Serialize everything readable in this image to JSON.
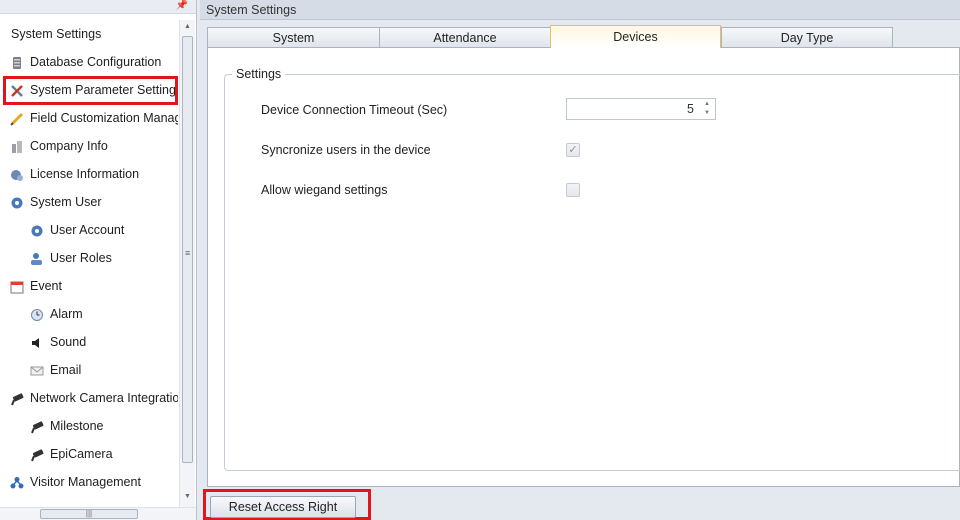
{
  "left_panel": {
    "tree": [
      {
        "label": "System Settings",
        "icon": "none",
        "level": "root"
      },
      {
        "label": "Database Configuration",
        "icon": "database-icon",
        "level": "l1"
      },
      {
        "label": "System Parameter Settings",
        "icon": "tools-icon",
        "level": "l1",
        "selected": true
      },
      {
        "label": "Field Customization Manage",
        "icon": "pencil-icon",
        "level": "l1"
      },
      {
        "label": "Company Info",
        "icon": "building-icon",
        "level": "l1"
      },
      {
        "label": "License Information",
        "icon": "license-icon",
        "level": "l1"
      },
      {
        "label": "System User",
        "icon": "gear-icon",
        "level": "l1"
      },
      {
        "label": "User Account",
        "icon": "gear-icon",
        "level": "l2"
      },
      {
        "label": "User Roles",
        "icon": "user-icon",
        "level": "l2"
      },
      {
        "label": "Event",
        "icon": "calendar-icon",
        "level": "l1"
      },
      {
        "label": "Alarm",
        "icon": "clock-icon",
        "level": "l2"
      },
      {
        "label": "Sound",
        "icon": "speaker-icon",
        "level": "l2"
      },
      {
        "label": "Email",
        "icon": "envelope-icon",
        "level": "l2"
      },
      {
        "label": "Network Camera Integration",
        "icon": "camera-icon",
        "level": "l1"
      },
      {
        "label": "Milestone",
        "icon": "camera-icon",
        "level": "l2"
      },
      {
        "label": "EpiCamera",
        "icon": "camera-icon",
        "level": "l2"
      },
      {
        "label": "Visitor Management",
        "icon": "visitor-icon",
        "level": "l1"
      }
    ]
  },
  "right_panel": {
    "title": "System Settings",
    "tabs": [
      {
        "label": "System",
        "active": false
      },
      {
        "label": "Attendance",
        "active": false
      },
      {
        "label": "Devices",
        "active": true
      },
      {
        "label": "Day Type",
        "active": false
      }
    ],
    "group_title": "Settings",
    "fields": {
      "timeout_label": "Device Connection Timeout (Sec)",
      "timeout_value": "5",
      "sync_label": "Syncronize users in the device",
      "sync_checked": true,
      "wiegand_label": "Allow wiegand settings",
      "wiegand_checked": false
    },
    "reset_button": "Reset Access Right"
  },
  "colors": {
    "highlight_red": "#e0161e",
    "active_tab": "#fff7e1",
    "panel_bg": "#e4e8ef"
  }
}
